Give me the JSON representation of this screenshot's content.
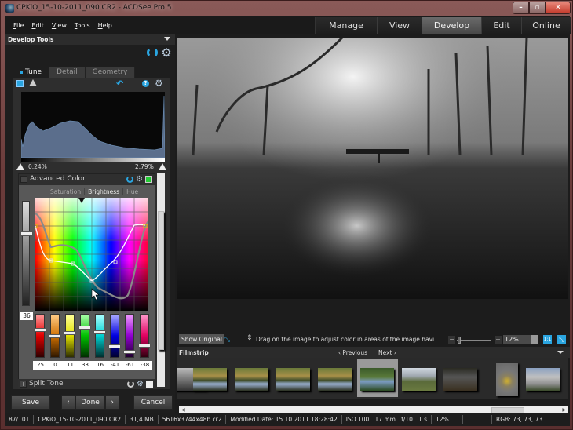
{
  "window": {
    "title": "CPKiO_15-10-2011_090.CR2 - ACDSee Pro 5",
    "controls": {
      "minimize": "–",
      "maximize": "▫",
      "close": "✕"
    }
  },
  "menu": {
    "items": [
      "File",
      "Edit",
      "View",
      "Tools",
      "Help"
    ]
  },
  "mode_tabs": [
    {
      "label": "Manage",
      "active": false
    },
    {
      "label": "View",
      "active": false
    },
    {
      "label": "Develop",
      "active": true
    },
    {
      "label": "Edit",
      "active": false
    },
    {
      "label": "Online",
      "active": false
    }
  ],
  "develop_tools": {
    "header": "Develop Tools",
    "tabs": [
      {
        "label": "Tune",
        "active": true
      },
      {
        "label": "Detail",
        "active": false
      },
      {
        "label": "Geometry",
        "active": false
      }
    ],
    "histogram": {
      "shadow_clip": "0.24%",
      "highlight_clip": "2.79%"
    },
    "advanced_color": {
      "title": "Advanced Color",
      "enabled_color": "#22cc33",
      "subtabs": [
        {
          "label": "Saturation",
          "active": false
        },
        {
          "label": "Brightness",
          "active": true
        },
        {
          "label": "Hue",
          "active": false
        }
      ],
      "master_value": "36",
      "master_level": 0.3,
      "sliders": [
        {
          "name": "red",
          "value": "25",
          "colors": [
            "#ff9999",
            "#e00000",
            "#300000"
          ]
        },
        {
          "name": "orange",
          "value": "0",
          "colors": [
            "#ffcc88",
            "#d07000",
            "#301800"
          ]
        },
        {
          "name": "yellow",
          "value": "11",
          "colors": [
            "#ffff99",
            "#e0e000",
            "#303000"
          ]
        },
        {
          "name": "green",
          "value": "33",
          "colors": [
            "#aaffaa",
            "#00c000",
            "#003000"
          ]
        },
        {
          "name": "cyan",
          "value": "16",
          "colors": [
            "#aaffff",
            "#00d0d0",
            "#003030"
          ]
        },
        {
          "name": "blue",
          "value": "-41",
          "colors": [
            "#aaaaff",
            "#0000e0",
            "#000030"
          ]
        },
        {
          "name": "purple",
          "value": "-61",
          "colors": [
            "#ee99ff",
            "#9000d0",
            "#200030"
          ]
        },
        {
          "name": "magenta",
          "value": "-38",
          "colors": [
            "#ff99cc",
            "#e00060",
            "#300010"
          ]
        }
      ]
    },
    "split_tone": {
      "title": "Split Tone"
    },
    "buttons": {
      "save": "Save",
      "prev": "‹",
      "done": "Done",
      "next": "›",
      "cancel": "Cancel"
    }
  },
  "viewer": {
    "show_original": "Show Original",
    "hint": "Drag on the image to adjust color in areas of the image havi...",
    "zoom_value": "12%",
    "btn_actual": "1:1",
    "btn_fit": "⤡"
  },
  "filmstrip": {
    "title": "Filmstrip",
    "prev": "‹ Previous",
    "next": "Next ›",
    "thumbnails": [
      {
        "kind": "partial",
        "selected": false
      },
      {
        "kind": "pond-bridge",
        "selected": false
      },
      {
        "kind": "pond-bridge",
        "selected": false
      },
      {
        "kind": "pond-bridge",
        "selected": false
      },
      {
        "kind": "pond-bridge",
        "selected": false
      },
      {
        "kind": "pond-green",
        "selected": true
      },
      {
        "kind": "river-path",
        "selected": false
      },
      {
        "kind": "dark-interior",
        "selected": false
      },
      {
        "kind": "arch-portrait",
        "selected": false
      },
      {
        "kind": "palace",
        "selected": false
      },
      {
        "kind": "partial",
        "selected": false
      }
    ]
  },
  "status": {
    "index": "87/101",
    "filename": "CPKiO_15-10-2011_090.CR2",
    "size": "31,4 MB",
    "dimensions": "5616x3744x48b cr2",
    "modified": "Modified Date: 15.10.2011 18:28:42",
    "exif": "ISO 100   17 mm   f/10   1 s",
    "zoom": "12%",
    "rgb": "RGB: 73, 73, 73"
  }
}
